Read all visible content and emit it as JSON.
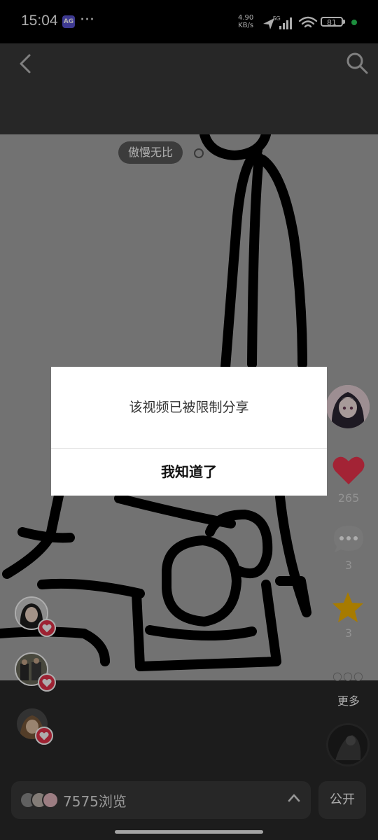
{
  "status_bar": {
    "time": "15:04",
    "app_badge": "AG",
    "overflow": "···",
    "net_speed_value": "4.90",
    "net_speed_unit": "KB/s",
    "network_type": "5G",
    "battery": "81"
  },
  "header": {
    "back_icon": "chevron-left-icon",
    "search_icon": "search-icon"
  },
  "post": {
    "tag": "傲慢无比"
  },
  "side_actions": {
    "likes": "265",
    "comments": "3",
    "favorites": "3",
    "more_label": "更多",
    "like_color": "#f0344e",
    "star_color": "#f7b500"
  },
  "dialog": {
    "message": "该视频已被限制分享",
    "confirm_label": "我知道了"
  },
  "bottom_bar": {
    "views_text": "7575浏览",
    "public_label": "公开"
  }
}
